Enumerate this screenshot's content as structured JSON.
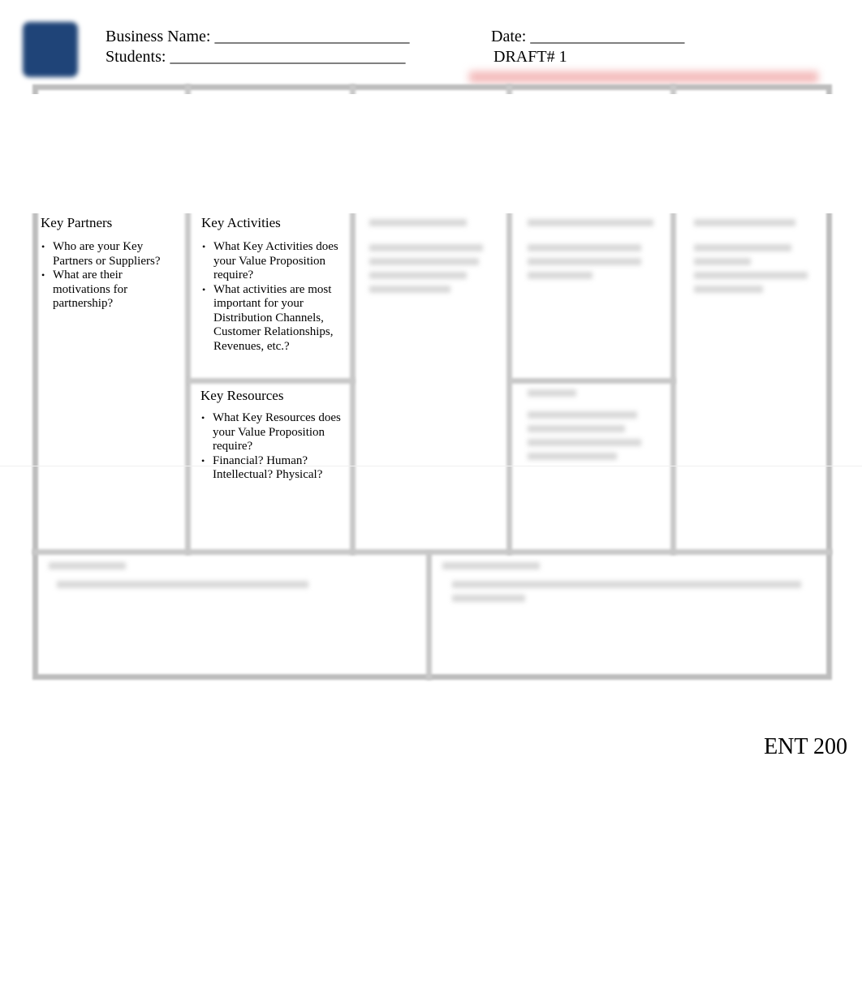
{
  "header": {
    "business_name_label": "Business Name:",
    "business_name_value": "________________________",
    "date_label": "Date:",
    "date_value": "___________________",
    "students_label": "Students:",
    "students_value": "_____________________________",
    "draft_label": "DRAFT# 1"
  },
  "blocks": {
    "key_partners": {
      "title": "Key Partners",
      "bullets": [
        "Who are your Key Partners or Suppliers?",
        "What are their motivations for partnership?"
      ]
    },
    "key_activities": {
      "title": "Key Activities",
      "bullets": [
        "What Key Activities does your Value Proposition require?",
        "What activities are most important for your Distribution Channels, Customer Relationships, Revenues, etc.?"
      ]
    },
    "key_resources": {
      "title": "Key Resources",
      "bullets": [
        "What Key Resources does your Value Proposition require?",
        "Financial?  Human? Intellectual?  Physical?"
      ]
    }
  },
  "colors": {
    "logo": "#1f4478",
    "border": "#bdbdbd",
    "redacted": "#f3b8b8"
  },
  "footer": {
    "course": "ENT 200"
  }
}
